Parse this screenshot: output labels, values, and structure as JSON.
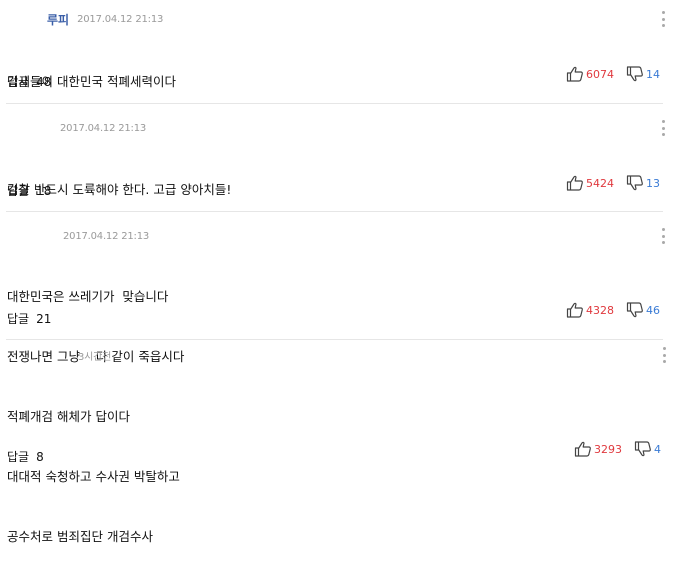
{
  "comments": [
    {
      "author": "루피",
      "time": "2017.04.12 21:13",
      "lines": [
        "검새들이 대한민국 적폐세력이다"
      ],
      "reply_label": "답글",
      "reply_count": "48",
      "likes": "6074",
      "dislikes": "14"
    },
    {
      "author": "",
      "time": "2017.04.12 21:13",
      "lines": [
        "검찰 반드시 도륙해야 한다. 고급 양아치들!"
      ],
      "reply_label": "답글",
      "reply_count": "18",
      "likes": "5424",
      "dislikes": "13"
    },
    {
      "author": "",
      "time": "2017.04.12 21:13",
      "lines": [
        "대한민국은 쓰레기가  맞습니다",
        "전쟁나면 그냥    다 같이 죽읍시다"
      ],
      "reply_label": "답글",
      "reply_count": "21",
      "likes": "4328",
      "dislikes": "46"
    },
    {
      "author": "",
      "time": "3시간전",
      "lines": [
        "적폐개검 해체가 답이다",
        "대대적 숙청하고 수사권 박탈하고",
        "공수처로 범죄집단 개검수사"
      ],
      "reply_label": "답글",
      "reply_count": "8",
      "likes": "3293",
      "dislikes": "4"
    }
  ],
  "icons": {
    "more": "more-vertical-icon",
    "like": "thumbs-up-icon",
    "dislike": "thumbs-down-icon"
  },
  "colors": {
    "author": "#3b5fa8",
    "likes": "#e0393e",
    "dislikes": "#3a7bd5",
    "divider": "#e6e6e6"
  }
}
